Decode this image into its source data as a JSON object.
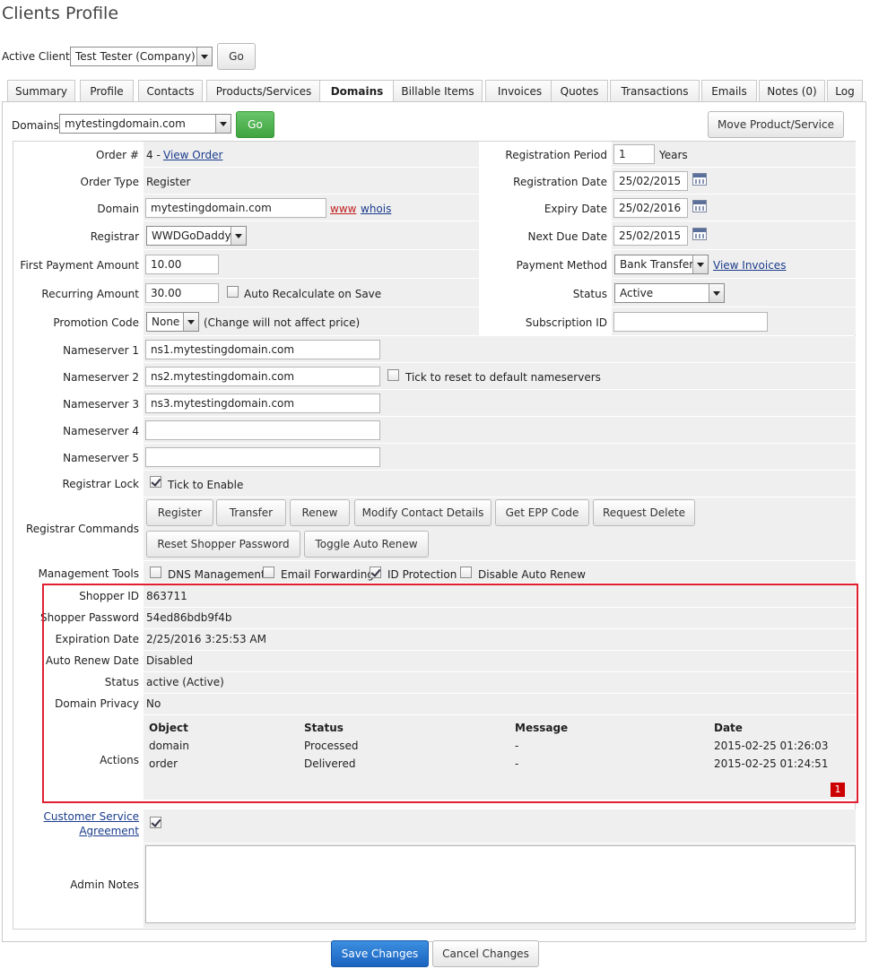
{
  "page_title": "Clients Profile",
  "active_client": {
    "label": "Active Client:",
    "value": "Test Tester (Company)",
    "go": "Go"
  },
  "tabs": [
    "Summary",
    "Profile",
    "Contacts",
    "Products/Services",
    "Domains",
    "Billable Items",
    "Invoices",
    "Quotes",
    "Transactions",
    "Emails",
    "Notes (0)",
    "Log"
  ],
  "domains_bar": {
    "label": "Domains:",
    "value": "mytestingdomain.com",
    "go": "Go",
    "move": "Move Product/Service"
  },
  "left": {
    "order_label": "Order #",
    "order_value": "4 - ",
    "view_order": "View Order",
    "order_type_label": "Order Type",
    "order_type_value": "Register",
    "domain_label": "Domain",
    "domain_value": "mytestingdomain.com",
    "www": "www",
    "whois": "whois",
    "registrar_label": "Registrar",
    "registrar_value": "WWDGoDaddy",
    "first_payment_label": "First Payment Amount",
    "first_payment_value": "10.00",
    "recurring_label": "Recurring Amount",
    "recurring_value": "30.00",
    "auto_recalc": "Auto Recalculate on Save",
    "promo_label": "Promotion Code",
    "promo_value": "None",
    "promo_note": "(Change will not affect price)"
  },
  "right": {
    "reg_period_label": "Registration Period",
    "reg_period_value": "1",
    "years": "Years",
    "reg_date_label": "Registration Date",
    "reg_date_value": "25/02/2015",
    "expiry_label": "Expiry Date",
    "expiry_value": "25/02/2016",
    "next_due_label": "Next Due Date",
    "next_due_value": "25/02/2015",
    "payment_method_label": "Payment Method",
    "payment_method_value": "Bank Transfer",
    "view_invoices": "View Invoices",
    "status_label": "Status",
    "status_value": "Active",
    "subscription_label": "Subscription ID",
    "subscription_value": ""
  },
  "nameservers": {
    "ns1_label": "Nameserver 1",
    "ns1": "ns1.mytestingdomain.com",
    "ns2_label": "Nameserver 2",
    "ns2": "ns2.mytestingdomain.com",
    "reset_ns": "Tick to reset to default nameservers",
    "ns3_label": "Nameserver 3",
    "ns3": "ns3.mytestingdomain.com",
    "ns4_label": "Nameserver 4",
    "ns4": "",
    "ns5_label": "Nameserver 5",
    "ns5": ""
  },
  "registrar_lock": {
    "label": "Registrar Lock",
    "text": "Tick to Enable"
  },
  "commands": {
    "label": "Registrar Commands",
    "register": "Register",
    "transfer": "Transfer",
    "renew": "Renew",
    "modify_contact": "Modify Contact Details",
    "get_epp": "Get EPP Code",
    "request_delete": "Request Delete",
    "reset_shopper": "Reset Shopper Password",
    "toggle_renew": "Toggle Auto Renew"
  },
  "management": {
    "label": "Management Tools",
    "dns": "DNS Management",
    "email_fwd": "Email Forwarding",
    "id_protect": "ID Protection",
    "disable_renew": "Disable Auto Renew"
  },
  "info": {
    "shopper_id_label": "Shopper ID",
    "shopper_id": "863711",
    "shopper_pw_label": "Shopper Password",
    "shopper_pw": "54ed86bdb9f4b",
    "expiration_label": "Expiration Date",
    "expiration": "2/25/2016 3:25:53 AM",
    "auto_renew_label": "Auto Renew Date",
    "auto_renew": "Disabled",
    "status_label": "Status",
    "status": "active (Active)",
    "privacy_label": "Domain Privacy",
    "privacy": "No",
    "actions_label": "Actions",
    "actions_headers": [
      "Object",
      "Status",
      "Message",
      "Date"
    ],
    "actions_rows": [
      [
        "domain",
        "Processed",
        "-",
        "2015-02-25 01:26:03"
      ],
      [
        "order",
        "Delivered",
        "-",
        "2015-02-25 01:24:51"
      ]
    ],
    "badge": "1"
  },
  "csa": {
    "line1": "Customer Service",
    "line2": "Agreement"
  },
  "admin_notes_label": "Admin Notes",
  "footer": {
    "save": "Save Changes",
    "cancel": "Cancel Changes"
  }
}
